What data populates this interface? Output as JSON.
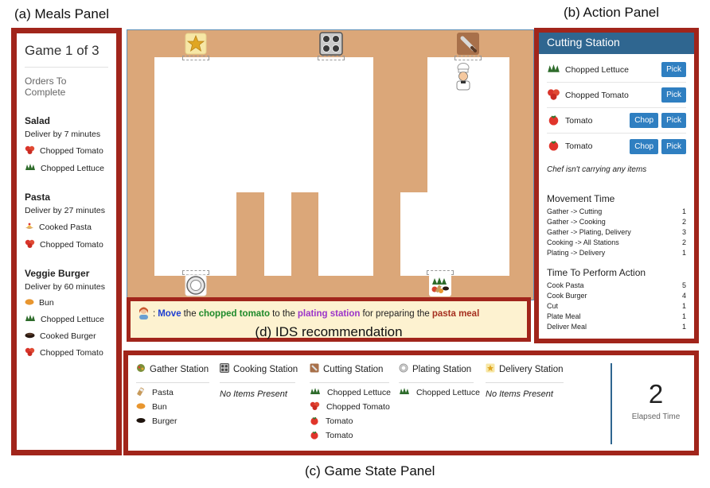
{
  "captions": {
    "meals_panel": "(a) Meals Panel",
    "action_panel": "(b) Action Panel",
    "game_state_panel": "(c) Game State Panel",
    "ids_panel": "(d) IDS recommendation"
  },
  "meals": {
    "game_title": "Game 1 of 3",
    "orders_heading": "Orders To Complete",
    "orders": [
      {
        "name": "Salad",
        "deadline": "Deliver by 7 minutes",
        "items": [
          {
            "label": "Chopped Tomato",
            "icon": "chopped-tomato-icon"
          },
          {
            "label": "Chopped Lettuce",
            "icon": "chopped-lettuce-icon"
          }
        ]
      },
      {
        "name": "Pasta",
        "deadline": "Deliver by 27 minutes",
        "items": [
          {
            "label": "Cooked Pasta",
            "icon": "cooked-pasta-icon"
          },
          {
            "label": "Chopped Tomato",
            "icon": "chopped-tomato-icon"
          }
        ]
      },
      {
        "name": "Veggie Burger",
        "deadline": "Deliver by 60 minutes",
        "items": [
          {
            "label": "Bun",
            "icon": "bun-icon"
          },
          {
            "label": "Chopped Lettuce",
            "icon": "chopped-lettuce-icon"
          },
          {
            "label": "Cooked Burger",
            "icon": "cooked-burger-icon"
          },
          {
            "label": "Chopped Tomato",
            "icon": "chopped-tomato-icon"
          }
        ]
      }
    ]
  },
  "kitchen": {
    "stations": [
      "delivery-station-icon",
      "cooking-station-icon",
      "cutting-station-icon",
      "plating-station-icon",
      "gather-station-icon"
    ],
    "chef": "chef-icon"
  },
  "ids": {
    "rec_icon": "advisor-avatar-icon",
    "colon": ":",
    "w1": "Move",
    "w2": "the",
    "w3": "chopped tomato",
    "w4": "to the",
    "w5": "plating station",
    "w6": "for preparing the",
    "w7": "pasta meal"
  },
  "action": {
    "station_title": "Cutting Station",
    "rows": [
      {
        "label": "Chopped Lettuce",
        "icon": "chopped-lettuce-icon",
        "buttons": [
          "Pick"
        ]
      },
      {
        "label": "Chopped Tomato",
        "icon": "chopped-tomato-icon",
        "buttons": [
          "Pick"
        ]
      },
      {
        "label": "Tomato",
        "icon": "tomato-icon",
        "buttons": [
          "Chop",
          "Pick"
        ]
      },
      {
        "label": "Tomato",
        "icon": "tomato-icon",
        "buttons": [
          "Chop",
          "Pick"
        ]
      }
    ],
    "carry_status": "Chef isn't carrying any items",
    "movement_title": "Movement Time",
    "movement": [
      {
        "label": "Gather -> Cutting",
        "value": "1"
      },
      {
        "label": "Gather -> Cooking",
        "value": "2"
      },
      {
        "label": "Gather -> Plating, Delivery",
        "value": "3"
      },
      {
        "label": "Cooking -> All Stations",
        "value": "2"
      },
      {
        "label": "Plating -> Delivery",
        "value": "1"
      }
    ],
    "perform_title": "Time To Perform Action",
    "perform": [
      {
        "label": "Cook Pasta",
        "value": "5"
      },
      {
        "label": "Cook Burger",
        "value": "4"
      },
      {
        "label": "Cut",
        "value": "1"
      },
      {
        "label": "Plate Meal",
        "value": "1"
      },
      {
        "label": "Deliver Meal",
        "value": "1"
      }
    ]
  },
  "game_state": {
    "columns": [
      {
        "name": "Gather Station",
        "icon": "gather-station-icon",
        "items": [
          {
            "label": "Pasta",
            "icon": "pasta-icon"
          },
          {
            "label": "Bun",
            "icon": "bun-icon"
          },
          {
            "label": "Burger",
            "icon": "burger-patty-icon"
          }
        ]
      },
      {
        "name": "Cooking Station",
        "icon": "cooking-station-icon",
        "empty": "No Items Present"
      },
      {
        "name": "Cutting Station",
        "icon": "cutting-station-icon",
        "items": [
          {
            "label": "Chopped Lettuce",
            "icon": "chopped-lettuce-icon"
          },
          {
            "label": "Chopped Tomato",
            "icon": "chopped-tomato-icon"
          },
          {
            "label": "Tomato",
            "icon": "tomato-icon"
          },
          {
            "label": "Tomato",
            "icon": "tomato-icon"
          }
        ]
      },
      {
        "name": "Plating Station",
        "icon": "plating-station-icon",
        "items": [
          {
            "label": "Chopped Lettuce",
            "icon": "chopped-lettuce-icon"
          }
        ]
      },
      {
        "name": "Delivery Station",
        "icon": "delivery-station-icon",
        "empty": "No Items Present"
      }
    ],
    "elapsed_value": "2",
    "elapsed_label": "Elapsed Time"
  },
  "colors": {
    "panel_border": "#a1251b",
    "header_blue": "#2f6690",
    "button_blue": "#2f7fc1",
    "kitchen_wall": "#dba779",
    "ids_background": "#fdf2d0"
  }
}
